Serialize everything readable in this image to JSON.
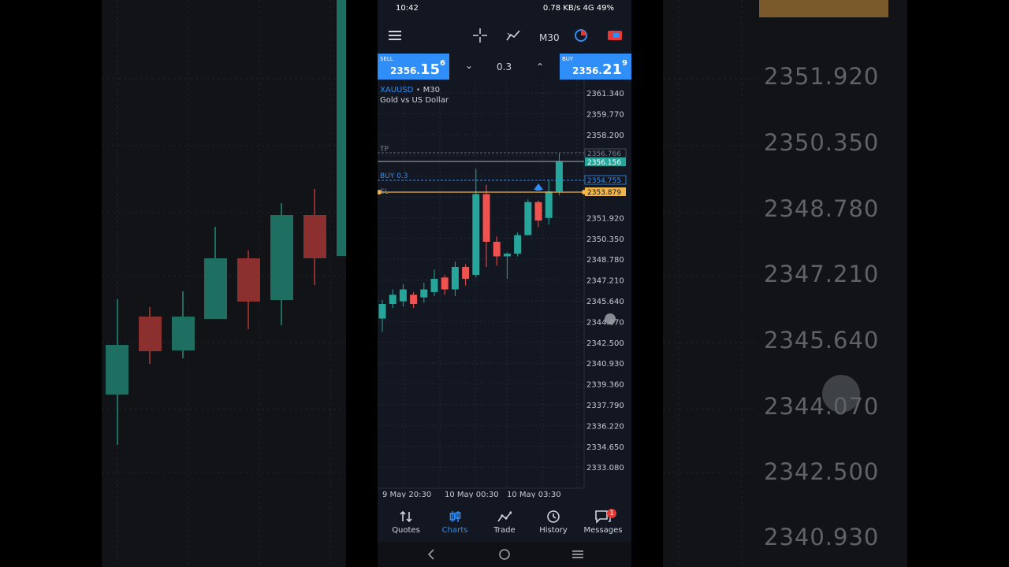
{
  "status_bar": {
    "time": "10:42",
    "indicators": "0.78 KB/s  4G  49%"
  },
  "toolbar": {
    "menu": "menu-icon",
    "crosshair": "crosshair-icon",
    "indicators": "indicators-icon",
    "timeframe": "M30",
    "objects": "objects-icon",
    "trade_mode": "trade-icon"
  },
  "trade_panel": {
    "sell_label": "SELL",
    "sell_price_prefix": "2356.",
    "sell_price_big": "15",
    "sell_price_sup": "6",
    "volume": "0.3",
    "buy_label": "BUY",
    "buy_price_prefix": "2356.",
    "buy_price_big": "21",
    "buy_price_sup": "9"
  },
  "chart_header": {
    "symbol": "XAUUSD",
    "timeframe": "M30",
    "description": "Gold vs US Dollar"
  },
  "chart_lines": {
    "tp_label": "TP",
    "tp_value": "2356.766",
    "bid_value": "2356.156",
    "buy_label": "BUY 0.3",
    "entry_value": "2354.755",
    "sl_label": "SL",
    "sl_value": "2353.879"
  },
  "chart_data": {
    "type": "candlestick",
    "y_ticks": [
      2361.34,
      2359.77,
      2358.2,
      2356.63,
      2355.06,
      2353.49,
      2351.92,
      2350.35,
      2348.78,
      2347.21,
      2345.64,
      2344.07,
      2342.5,
      2340.93,
      2339.36,
      2337.79,
      2336.22,
      2334.65,
      2333.08
    ],
    "y_tick_labels": [
      "2361.340",
      "2359.770",
      "2358.200",
      "",
      "",
      "",
      "2351.920",
      "2350.350",
      "2348.780",
      "2347.210",
      "2345.640",
      "2344.070",
      "2342.500",
      "2340.930",
      "2339.360",
      "2337.790",
      "2336.220",
      "2334.650",
      "2333.080"
    ],
    "x_labels": [
      "9 May 20:30",
      "10 May 00:30",
      "10 May 03:30"
    ],
    "candles": [
      {
        "o": 2344.3,
        "c": 2345.4,
        "h": 2345.7,
        "l": 2343.3
      },
      {
        "o": 2345.4,
        "c": 2346.1,
        "h": 2346.5,
        "l": 2345.1
      },
      {
        "o": 2345.6,
        "c": 2346.5,
        "h": 2346.9,
        "l": 2345.2
      },
      {
        "o": 2346.1,
        "c": 2345.4,
        "h": 2346.3,
        "l": 2345.1
      },
      {
        "o": 2345.9,
        "c": 2346.5,
        "h": 2347.0,
        "l": 2345.5
      },
      {
        "o": 2346.3,
        "c": 2347.3,
        "h": 2348.0,
        "l": 2346.0
      },
      {
        "o": 2347.4,
        "c": 2346.5,
        "h": 2347.6,
        "l": 2346.1
      },
      {
        "o": 2346.5,
        "c": 2348.2,
        "h": 2348.6,
        "l": 2346.0
      },
      {
        "o": 2348.2,
        "c": 2347.3,
        "h": 2348.4,
        "l": 2346.8
      },
      {
        "o": 2347.6,
        "c": 2353.7,
        "h": 2355.6,
        "l": 2347.4
      },
      {
        "o": 2353.7,
        "c": 2350.1,
        "h": 2354.4,
        "l": 2348.2
      },
      {
        "o": 2350.1,
        "c": 2349.0,
        "h": 2350.5,
        "l": 2348.3
      },
      {
        "o": 2349.0,
        "c": 2349.2,
        "h": 2349.3,
        "l": 2347.3
      },
      {
        "o": 2349.2,
        "c": 2350.6,
        "h": 2350.8,
        "l": 2349.0
      },
      {
        "o": 2350.6,
        "c": 2353.1,
        "h": 2353.3,
        "l": 2350.6
      },
      {
        "o": 2353.1,
        "c": 2351.7,
        "h": 2353.2,
        "l": 2351.2
      },
      {
        "o": 2351.9,
        "c": 2353.9,
        "h": 2354.8,
        "l": 2351.4
      },
      {
        "o": 2353.9,
        "c": 2356.2,
        "h": 2356.8,
        "l": 2353.6
      }
    ],
    "up_color": "#26a69a",
    "down_color": "#ef5350"
  },
  "bottom_nav": [
    {
      "label": "Quotes",
      "icon": "quotes-icon"
    },
    {
      "label": "Charts",
      "icon": "charts-icon",
      "active": true
    },
    {
      "label": "Trade",
      "icon": "trade-icon"
    },
    {
      "label": "History",
      "icon": "history-icon"
    },
    {
      "label": "Messages",
      "icon": "messages-icon",
      "badge": "1"
    }
  ],
  "background_zoom": {
    "price_labels": [
      "2351.920",
      "2350.350",
      "2348.780",
      "2347.210",
      "2345.640",
      "2344.070",
      "2342.500",
      "2340.930"
    ]
  }
}
